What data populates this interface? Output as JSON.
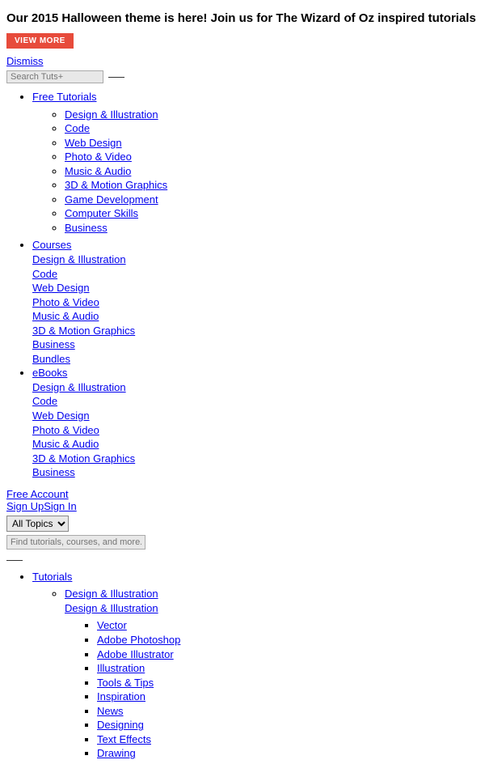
{
  "banner": {
    "text": "Our 2015 Halloween theme is here! Join us for The Wizard of Oz inspired tutorials",
    "button": "VIEW MORE"
  },
  "dismiss": "Dismiss",
  "search": {
    "placeholder": "Search Tuts+"
  },
  "nav": {
    "free_tutorials": {
      "label": "Free Tutorials",
      "items": [
        "Design & Illustration",
        "Code",
        "Web Design",
        "Photo & Video",
        "Music & Audio",
        "3D & Motion Graphics",
        "Game Development",
        "Computer Skills",
        "Business"
      ]
    },
    "courses": {
      "label": "Courses",
      "items": [
        "Design & Illustration",
        "Code",
        "Web Design",
        "Photo & Video",
        "Music & Audio",
        "3D & Motion Graphics",
        "Business",
        "Bundles"
      ]
    },
    "ebooks": {
      "label": "eBooks",
      "items": [
        "Design & Illustration",
        "Code",
        "Web Design",
        "Photo & Video",
        "Music & Audio",
        "3D & Motion Graphics",
        "Business"
      ]
    }
  },
  "account": {
    "free_account": "Free Account",
    "sign_up": "Sign Up",
    "sign_in": "Sign In"
  },
  "topic_select": {
    "selected": "All Topics"
  },
  "find": {
    "placeholder": "Find tutorials, courses, and more..."
  },
  "tutorials_nav": {
    "label": "Tutorials",
    "design_illustration": {
      "label": "Design & Illustration",
      "heading": "Design & Illustration",
      "items": [
        "Vector",
        "Adobe Photoshop",
        "Adobe Illustrator",
        "Illustration",
        "Tools & Tips",
        "Inspiration",
        "News",
        "Designing",
        "Text Effects",
        "Drawing"
      ]
    }
  }
}
